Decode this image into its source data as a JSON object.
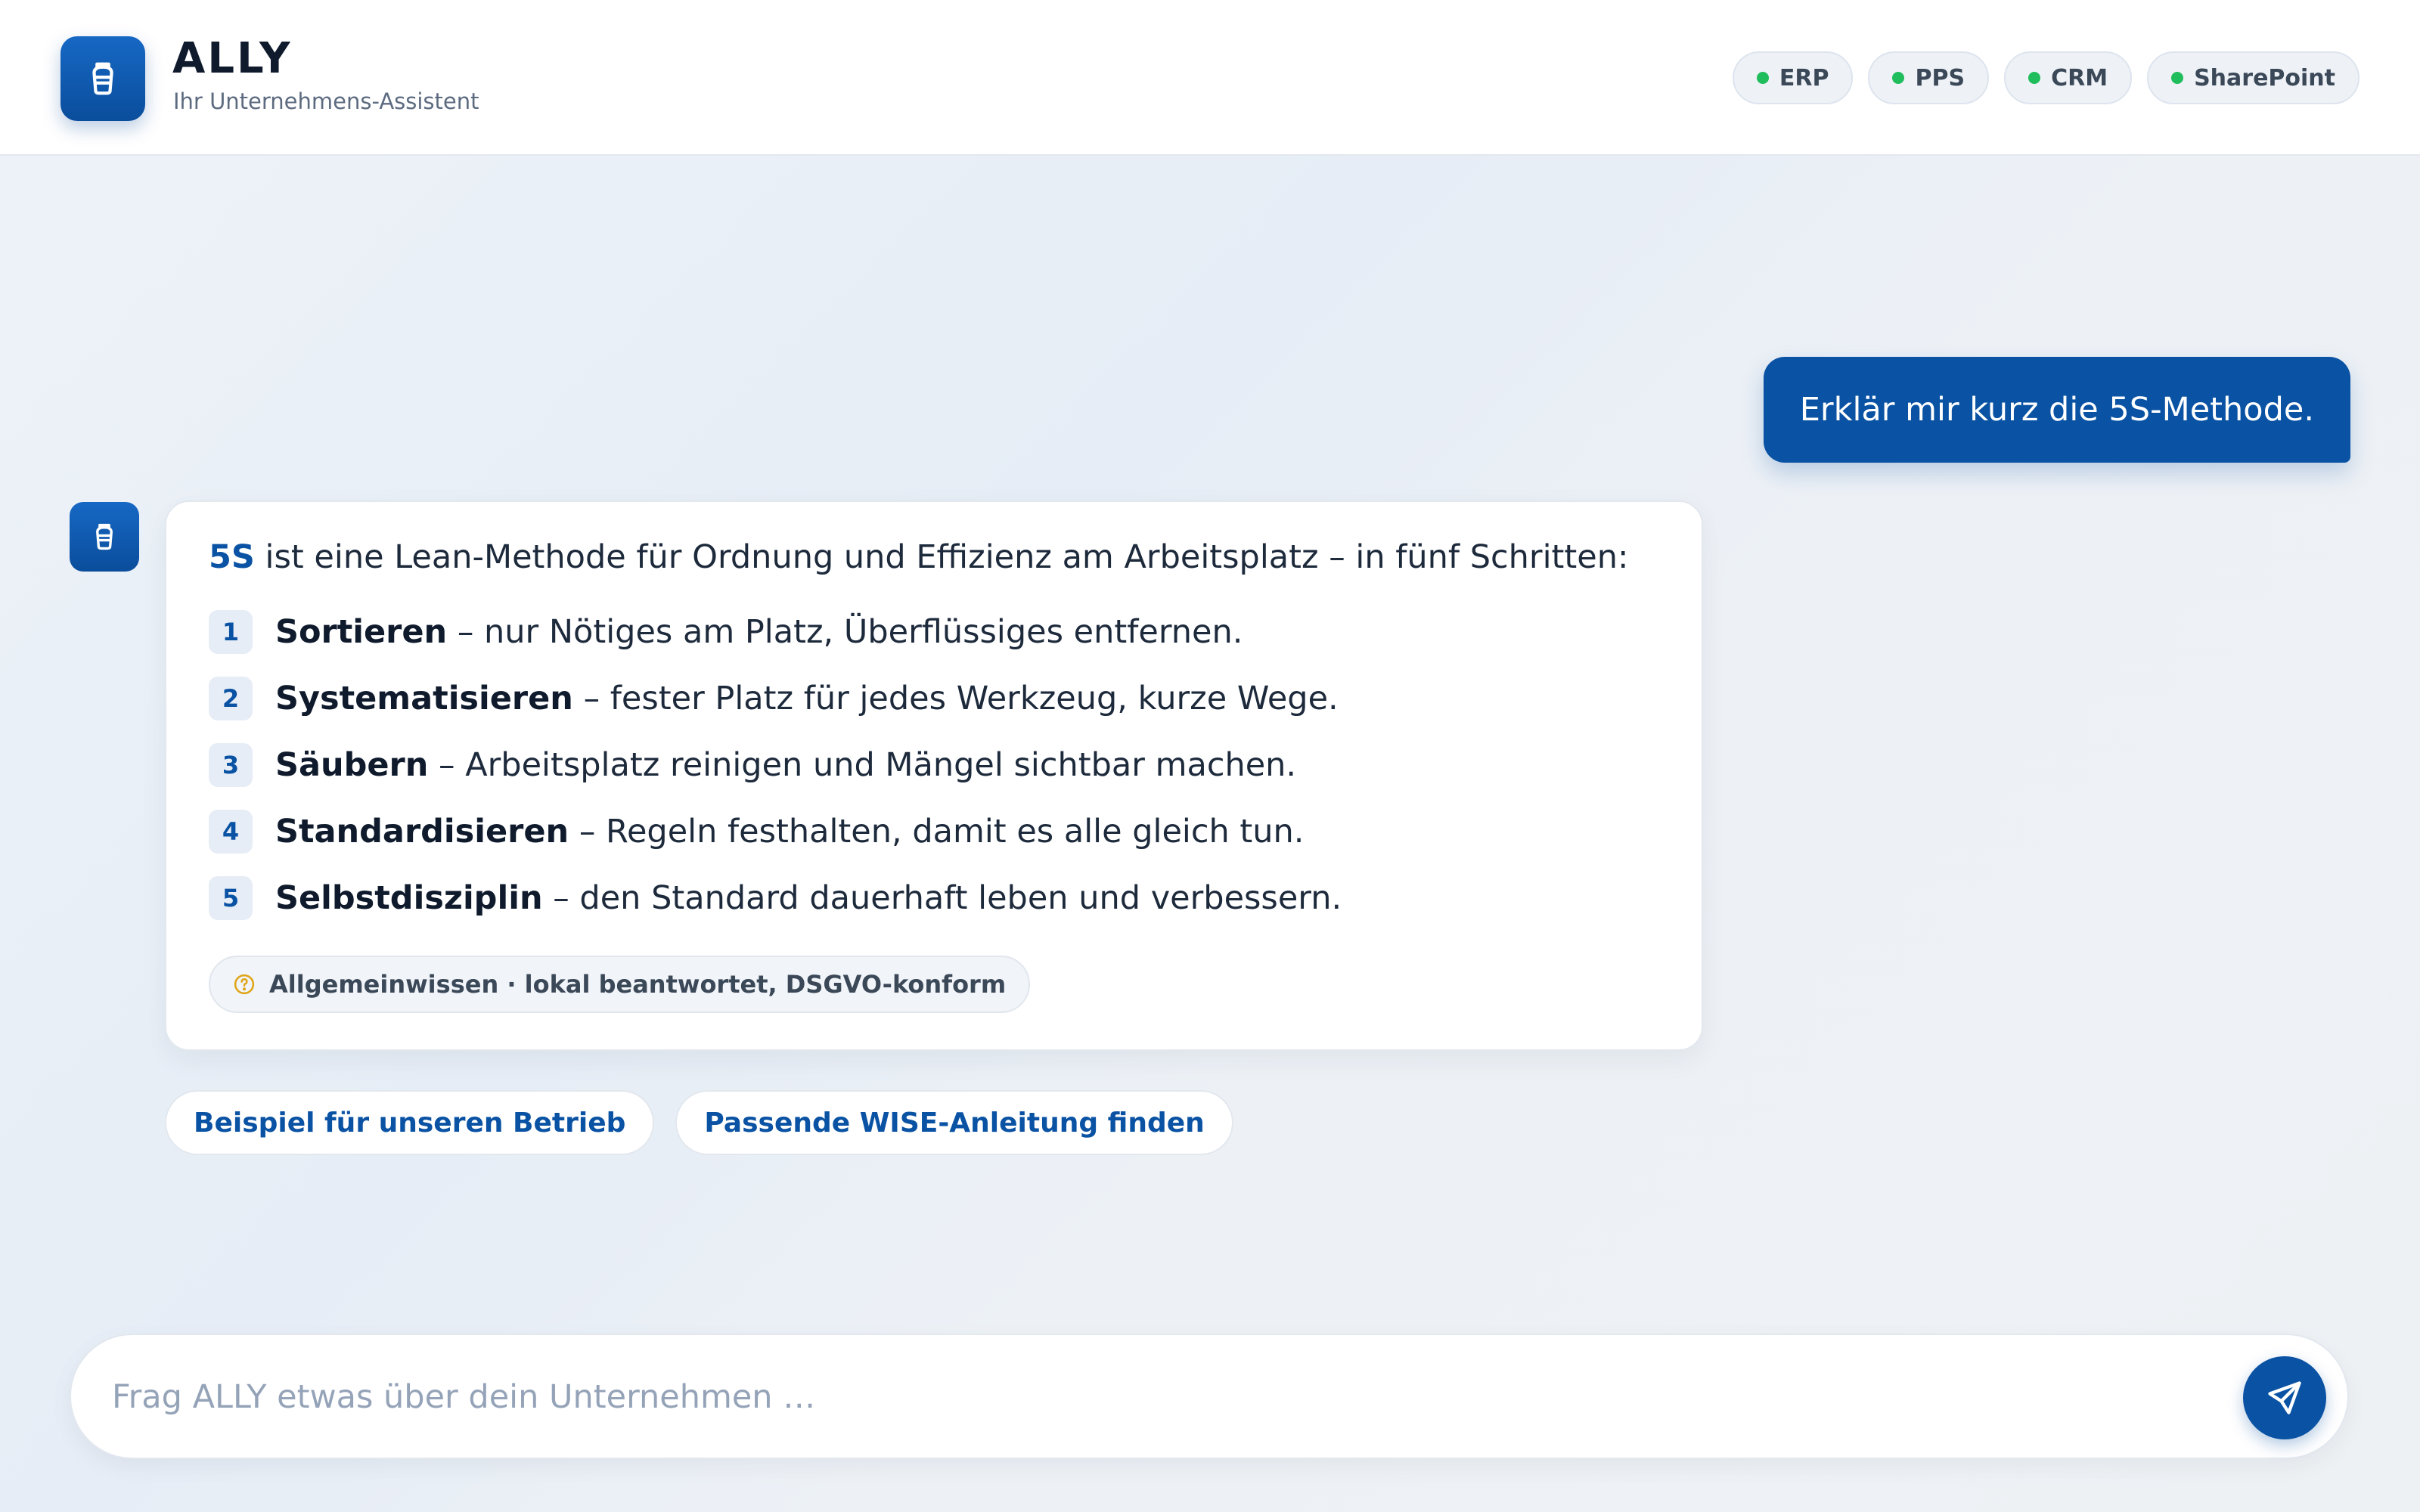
{
  "header": {
    "title": "ALLY",
    "subtitle": "Ihr Unternehmens-Assistent",
    "logo_icon": "assistant-cup-icon",
    "systems": [
      {
        "label": "ERP",
        "status_color": "#1fbd5b"
      },
      {
        "label": "PPS",
        "status_color": "#1fbd5b"
      },
      {
        "label": "CRM",
        "status_color": "#1fbd5b"
      },
      {
        "label": "SharePoint",
        "status_color": "#1fbd5b"
      }
    ]
  },
  "chat": {
    "user_message": "Erklär mir kurz die 5S-Methode.",
    "answer": {
      "intro_term": "5S",
      "intro_rest": " ist eine Lean-Methode für Ordnung und Effizienz am Arbeitsplatz – in fünf Schritten:",
      "steps": [
        {
          "num": "1",
          "term": "Sortieren",
          "desc": " – nur Nötiges am Platz, Überflüssiges entfernen."
        },
        {
          "num": "2",
          "term": "Systematisieren",
          "desc": " – fester Platz für jedes Werkzeug, kurze Wege."
        },
        {
          "num": "3",
          "term": "Säubern",
          "desc": " – Arbeitsplatz reinigen und Mängel sichtbar machen."
        },
        {
          "num": "4",
          "term": "Standardisieren",
          "desc": " – Regeln festhalten, damit es alle gleich tun."
        },
        {
          "num": "5",
          "term": "Selbstdisziplin",
          "desc": " – den Standard dauerhaft leben und verbessern."
        }
      ],
      "source_label": "Allgemeinwissen · lokal beantwortet, DSGVO-konform",
      "source_icon": "question-circle-icon"
    },
    "suggestions": [
      "Beispiel für unseren Betrieb",
      "Passende WISE-Anleitung finden"
    ]
  },
  "composer": {
    "placeholder": "Frag ALLY etwas über dein Unternehmen …",
    "value": "",
    "send_icon": "send-icon"
  },
  "colors": {
    "brand": "#0a52a3",
    "status_ok": "#1fbd5b",
    "source_icon": "#e0a415"
  }
}
